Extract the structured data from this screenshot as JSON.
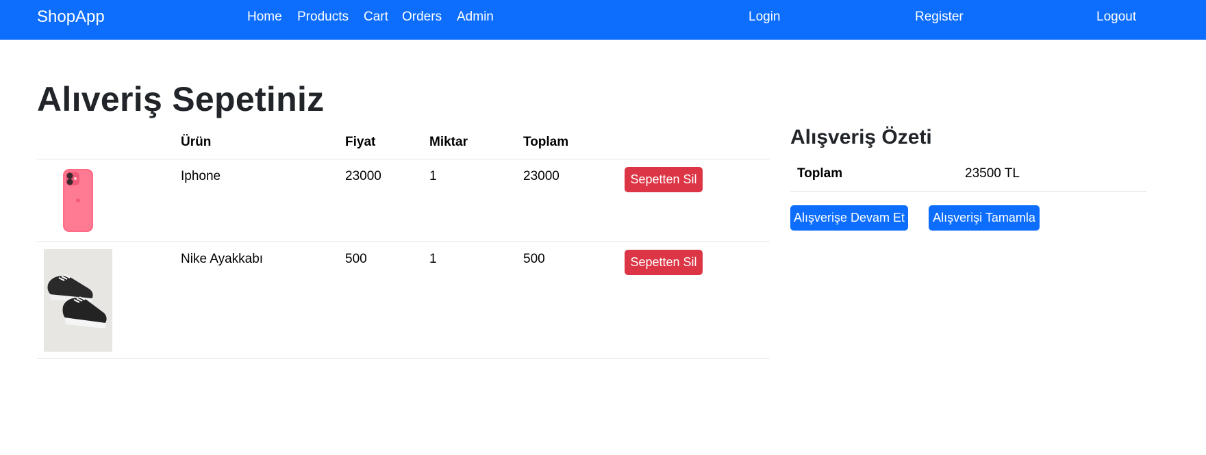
{
  "navbar": {
    "brand": "ShopApp",
    "links": [
      "Home",
      "Products",
      "Cart",
      "Orders",
      "Admin"
    ],
    "login": "Login",
    "register": "Register",
    "logout": "Logout",
    "color": "#0d6efd"
  },
  "page": {
    "title": "Alıveriş Sepetiniz"
  },
  "cart": {
    "headers": {
      "product": "Ürün",
      "price": "Fiyat",
      "quantity": "Miktar",
      "total": "Toplam"
    },
    "items": [
      {
        "name": "Iphone",
        "price": "23000",
        "quantity": "1",
        "total": "23000",
        "remove_label": "Sepetten Sil",
        "image_icon": "phone-product-image"
      },
      {
        "name": "Nike Ayakkabı",
        "price": "500",
        "quantity": "1",
        "total": "500",
        "remove_label": "Sepetten Sil",
        "image_icon": "sneakers-product-image"
      }
    ]
  },
  "summary": {
    "title": "Alışveriş Özeti",
    "total_label": "Toplam",
    "total_value": "23500 TL",
    "continue_label": "Alışverişe Devam Et",
    "checkout_label": "Alışverişi Tamamla"
  },
  "colors": {
    "primary": "#0d6efd",
    "danger": "#dc3545"
  }
}
